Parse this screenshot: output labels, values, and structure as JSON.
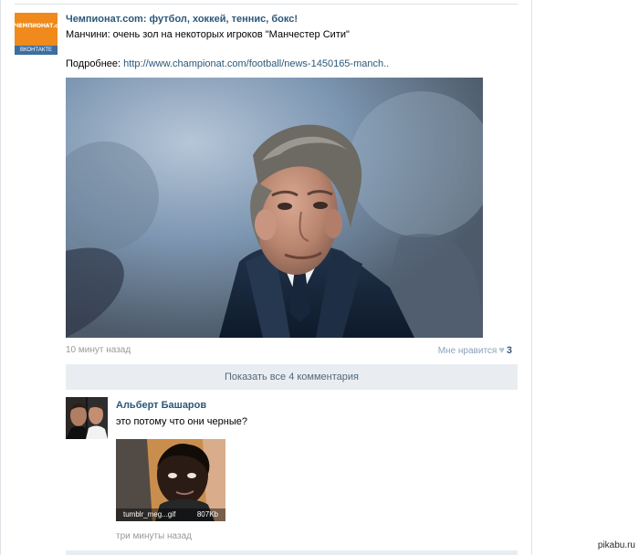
{
  "post": {
    "author": "Чемпионат.com: футбол, хоккей, теннис, бокс!",
    "avatar": {
      "brand": "ЧЕМПИОНАТ.com",
      "vk": "ВКОНТАКТЕ",
      "brand_color": "#f08a1c",
      "vk_color": "#3c6ea0"
    },
    "text": "Манчини: очень зол на некоторых игроков \"Манчестер Сити\"",
    "more_label": "Подробнее:",
    "more_link": "http://www.championat.com/football/news-1450165-manch..",
    "time": "10 минут назад",
    "like_label": "Мне нравится",
    "like_count": "3"
  },
  "comments": {
    "show_all": "Показать все 4 комментария",
    "items": [
      {
        "author": "Альберт Башаров",
        "text": "это потому что они черные?",
        "attachment": {
          "name": "tumblr_meg...gif",
          "size": "807Kb"
        },
        "time": "три минуты назад"
      }
    ]
  },
  "watermark": "pikabu.ru",
  "colors": {
    "link": "#2b587a",
    "muted": "#999999",
    "button_bg": "#e9edf1"
  }
}
